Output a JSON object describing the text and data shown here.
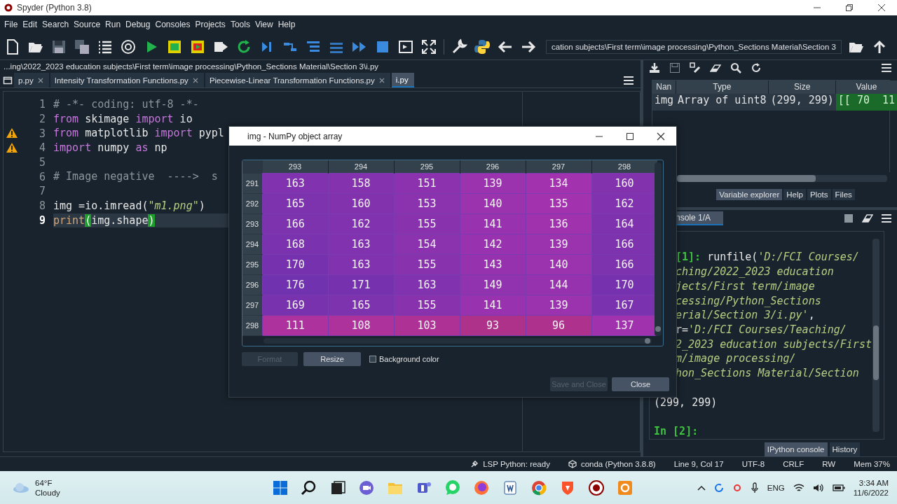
{
  "window": {
    "title": "Spyder (Python 3.8)"
  },
  "menu": [
    "File",
    "Edit",
    "Search",
    "Source",
    "Run",
    "Debug",
    "Consoles",
    "Projects",
    "Tools",
    "View",
    "Help"
  ],
  "toolbar": {
    "path": "cation subjects\\First term\\image processing\\Python_Sections Material\\Section 3"
  },
  "editor": {
    "file_path": "...ing\\2022_2023 education subjects\\First term\\image processing\\Python_Sections Material\\Section 3\\i.py",
    "tabs": [
      {
        "label": "p.py",
        "selected": false,
        "closable": true
      },
      {
        "label": "Intensity Transformation Functions.py",
        "selected": false,
        "closable": true
      },
      {
        "label": "Piecewise-Linear Transformation Functions.py",
        "selected": false,
        "closable": true
      },
      {
        "label": "i.py",
        "selected": true,
        "closable": false
      }
    ],
    "lines": [
      {
        "number": "1",
        "warning": false,
        "current": false,
        "tokens": [
          {
            "kind": "comment",
            "text": "# -*- coding: utf-8 -*-"
          }
        ]
      },
      {
        "number": "2",
        "warning": false,
        "current": false,
        "tokens": [
          {
            "kind": "keyword",
            "text": "from"
          },
          {
            "kind": "plain",
            "text": " skimage "
          },
          {
            "kind": "keyword",
            "text": "import"
          },
          {
            "kind": "plain",
            "text": " io"
          }
        ]
      },
      {
        "number": "3",
        "warning": true,
        "current": false,
        "tokens": [
          {
            "kind": "keyword",
            "text": "from"
          },
          {
            "kind": "plain",
            "text": " matplotlib "
          },
          {
            "kind": "keyword",
            "text": "import"
          },
          {
            "kind": "plain",
            "text": " pypl"
          }
        ]
      },
      {
        "number": "4",
        "warning": true,
        "current": false,
        "tokens": [
          {
            "kind": "keyword",
            "text": "import"
          },
          {
            "kind": "plain",
            "text": " numpy "
          },
          {
            "kind": "keyword",
            "text": "as"
          },
          {
            "kind": "plain",
            "text": " np"
          }
        ]
      },
      {
        "number": "5",
        "warning": false,
        "current": false
      },
      {
        "number": "6",
        "warning": false,
        "current": false,
        "tokens": [
          {
            "kind": "comment",
            "text": "# Image negative  ---->  s"
          }
        ]
      },
      {
        "number": "7",
        "warning": false,
        "current": false
      },
      {
        "number": "8",
        "warning": false,
        "current": false,
        "tokens": [
          {
            "kind": "plain",
            "text": "img =io.imread("
          },
          {
            "kind": "string",
            "text": "\"m1.png\""
          },
          {
            "kind": "plain",
            "text": ")"
          }
        ]
      },
      {
        "number": "9",
        "warning": false,
        "current": true,
        "tokens": [
          {
            "kind": "builtin",
            "text": "print"
          },
          {
            "kind": "match",
            "text": "("
          },
          {
            "kind": "plain",
            "text": "img.shape"
          },
          {
            "kind": "match",
            "text": ")"
          }
        ]
      }
    ]
  },
  "variable_explorer": {
    "columns": [
      "Nan",
      "Type",
      "Size",
      "Value"
    ],
    "rows": [
      {
        "name": "img",
        "type": "Array of uint8",
        "size": "(299, 299)",
        "value": "[[ 70  11"
      }
    ],
    "tabs": [
      {
        "label": "Variable explorer",
        "selected": true
      },
      {
        "label": "Help",
        "selected": false
      },
      {
        "label": "Plots",
        "selected": false
      },
      {
        "label": "Files",
        "selected": false
      }
    ]
  },
  "console": {
    "tab": "nsole 1/A",
    "lines": [
      {
        "kind": "input",
        "tokens": [
          {
            "kind": "prompt",
            "text": "[1]:"
          },
          {
            "kind": "plain",
            "text": " runfile("
          },
          {
            "kind": "string",
            "text": "'D:/FCI Courses/"
          }
        ]
      },
      {
        "kind": "input",
        "tokens": [
          {
            "kind": "string",
            "text": "ching/2022_2023 education"
          }
        ]
      },
      {
        "kind": "input",
        "tokens": [
          {
            "kind": "string",
            "text": "jects/First term/image"
          }
        ]
      },
      {
        "kind": "input",
        "tokens": [
          {
            "kind": "string",
            "text": "cessing/Python_Sections"
          }
        ]
      },
      {
        "kind": "input",
        "tokens": [
          {
            "kind": "string",
            "text": "erial/Section 3/i.py'"
          },
          {
            "kind": "plain",
            "text": ","
          }
        ]
      },
      {
        "kind": "input",
        "tokens": [
          {
            "kind": "plain",
            "text": "r="
          },
          {
            "kind": "string",
            "text": "'D:/FCI Courses/Teaching/"
          }
        ]
      },
      {
        "kind": "input",
        "tokens": [
          {
            "kind": "string",
            "text": "2_2023 education subjects/First"
          }
        ]
      },
      {
        "kind": "input",
        "tokens": [
          {
            "kind": "string",
            "text": "m/image processing/"
          }
        ]
      },
      {
        "kind": "input",
        "tokens": [
          {
            "kind": "string",
            "text": "hon_Sections Material/Section"
          }
        ]
      },
      {
        "kind": "output",
        "tokens": [
          {
            "kind": "plain",
            "text": "(299, 299)"
          }
        ]
      },
      {
        "kind": "prompt",
        "tokens": [
          {
            "kind": "prompt",
            "text": "In [2]:"
          }
        ]
      }
    ],
    "tabs": [
      {
        "label": "IPython console",
        "selected": true
      },
      {
        "label": "History",
        "selected": false
      }
    ]
  },
  "status_bar": [
    {
      "kind": "lsp",
      "text": "LSP Python: ready"
    },
    {
      "kind": "env",
      "text": "conda (Python 3.8.8)"
    },
    {
      "kind": "plain",
      "text": "Line 9, Col 17"
    },
    {
      "kind": "plain",
      "text": "UTF-8"
    },
    {
      "kind": "plain",
      "text": "CRLF"
    },
    {
      "kind": "plain",
      "text": "RW"
    },
    {
      "kind": "plain",
      "text": "Mem 37%"
    }
  ],
  "taskbar": {
    "temperature": "64°F",
    "weather": "Cloudy",
    "language": "ENG",
    "time": "3:34 AM",
    "date": "11/6/2022"
  },
  "dialog": {
    "title": "img - NumPy object array",
    "columns": [
      "293",
      "294",
      "295",
      "296",
      "297",
      "298"
    ],
    "rows": [
      {
        "header": "291",
        "cells": [
          "163",
          "158",
          "151",
          "139",
          "134",
          "160"
        ]
      },
      {
        "header": "292",
        "cells": [
          "165",
          "160",
          "153",
          "140",
          "135",
          "162"
        ]
      },
      {
        "header": "293",
        "cells": [
          "166",
          "162",
          "155",
          "141",
          "136",
          "164"
        ]
      },
      {
        "header": "294",
        "cells": [
          "168",
          "163",
          "154",
          "142",
          "139",
          "166"
        ]
      },
      {
        "header": "295",
        "cells": [
          "170",
          "163",
          "155",
          "143",
          "140",
          "166"
        ]
      },
      {
        "header": "296",
        "cells": [
          "176",
          "171",
          "163",
          "149",
          "144",
          "170"
        ]
      },
      {
        "header": "297",
        "cells": [
          "169",
          "165",
          "155",
          "141",
          "139",
          "167"
        ]
      },
      {
        "header": "298",
        "cells": [
          "111",
          "108",
          "103",
          "93",
          "96",
          "137"
        ]
      }
    ],
    "format_button": {
      "label": "Format",
      "disabled": true
    },
    "resize_button": {
      "label": "Resize",
      "disabled": false
    },
    "background_color": {
      "label": "Background color",
      "checked": false
    },
    "save_button": {
      "label": "Save and Close",
      "disabled": true
    },
    "close_button": {
      "label": "Close",
      "disabled": false
    }
  }
}
